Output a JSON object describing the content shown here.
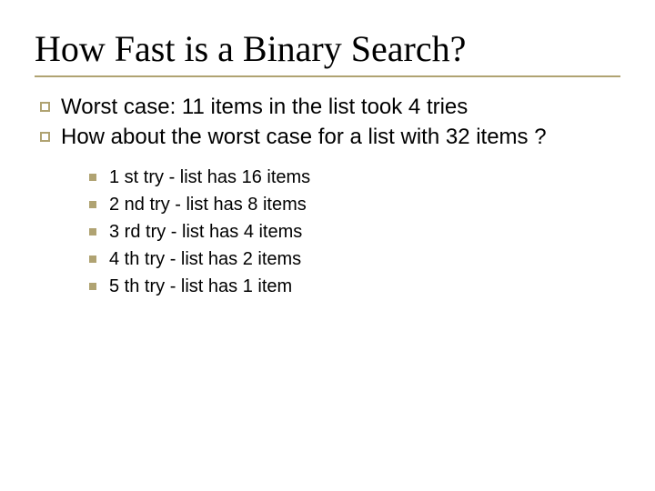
{
  "title": "How Fast is a Binary Search?",
  "bullets": [
    "Worst case: 11 items in the list took 4 tries",
    "How about the worst case for a list with 32 items ?"
  ],
  "sub_bullets": [
    "1 st try - list has 16 items",
    "2 nd try - list has 8 items",
    "3 rd try - list has 4 items",
    "4 th try - list has 2 items",
    "5 th try - list has 1 item"
  ]
}
